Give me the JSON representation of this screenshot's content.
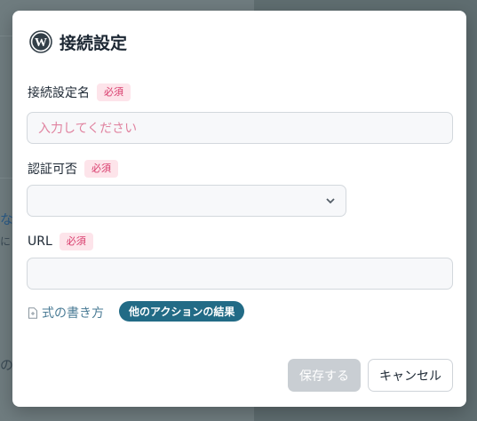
{
  "background": {
    "fragment_1": "な",
    "fragment_2": "に",
    "fragment_3": "のこ"
  },
  "modal": {
    "icon": "wordpress-icon",
    "title": "接続設定"
  },
  "form": {
    "required_badge": "必須",
    "connection_name": {
      "label": "接続設定名",
      "placeholder": "入力してください",
      "value": ""
    },
    "auth": {
      "label": "認証可否",
      "selected": ""
    },
    "url": {
      "label": "URL",
      "value": ""
    }
  },
  "links": {
    "formula_help": "式の書き方",
    "other_action_results": "他のアクションの結果"
  },
  "buttons": {
    "save": "保存する",
    "cancel": "キャンセル"
  },
  "colors": {
    "accent": "#226b86",
    "required_bg": "#fde4ea",
    "required_text": "#d83a6b",
    "disabled_button": "#c9ced3"
  }
}
